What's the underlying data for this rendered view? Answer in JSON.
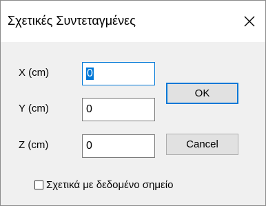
{
  "window": {
    "title": "Σχετικές Συντεταγμένες"
  },
  "fields": [
    {
      "label": "X (cm)",
      "value": "0",
      "focused": true
    },
    {
      "label": "Y (cm)",
      "value": "0",
      "focused": false
    },
    {
      "label": "Z (cm)",
      "value": "0",
      "focused": false
    }
  ],
  "buttons": {
    "ok_label": "OK",
    "cancel_label": "Cancel"
  },
  "checkbox": {
    "label": "Σχετικά με δεδομένο σημείο",
    "checked": false
  },
  "icons": {
    "close": "close-icon"
  },
  "colors": {
    "accent": "#0078d7",
    "dialog_bg": "#f0f0f0",
    "button_bg": "#e1e1e1"
  }
}
